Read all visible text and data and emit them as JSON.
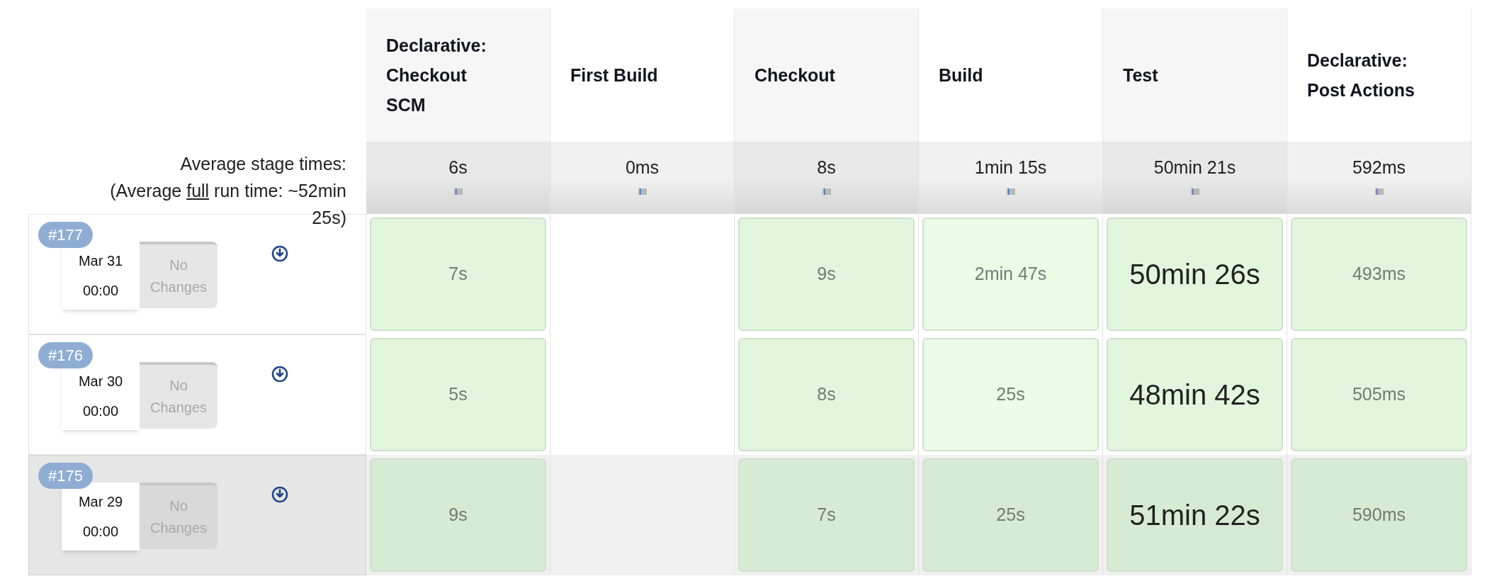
{
  "stages": [
    {
      "name": "Declarative: Checkout SCM",
      "average": "6s"
    },
    {
      "name": "First Build",
      "average": "0ms"
    },
    {
      "name": "Checkout",
      "average": "8s"
    },
    {
      "name": "Build",
      "average": "1min 15s"
    },
    {
      "name": "Test",
      "average": "50min 21s"
    },
    {
      "name": "Declarative: Post Actions",
      "average": "592ms"
    }
  ],
  "average_label": "Average stage times:",
  "average_run_time": {
    "before": "(Average ",
    "link": "full",
    "after": " run time: ~52min 25s)"
  },
  "builds": [
    {
      "number": "#177",
      "date": "Mar 31",
      "time": "00:00",
      "changes": "No Changes",
      "highlighted": false,
      "cells": [
        {
          "kind": "success",
          "duration": "7s",
          "long": false
        },
        {
          "kind": "empty"
        },
        {
          "kind": "success",
          "duration": "9s",
          "long": false
        },
        {
          "kind": "success",
          "duration": "2min 47s",
          "long": false
        },
        {
          "kind": "success",
          "duration": "50min 26s",
          "long": true
        },
        {
          "kind": "success",
          "duration": "493ms",
          "long": false
        }
      ]
    },
    {
      "number": "#176",
      "date": "Mar 30",
      "time": "00:00",
      "changes": "No Changes",
      "highlighted": false,
      "cells": [
        {
          "kind": "success",
          "duration": "5s",
          "long": false
        },
        {
          "kind": "empty"
        },
        {
          "kind": "success",
          "duration": "8s",
          "long": false
        },
        {
          "kind": "success",
          "duration": "25s",
          "long": false
        },
        {
          "kind": "success",
          "duration": "48min 42s",
          "long": true
        },
        {
          "kind": "success",
          "duration": "505ms",
          "long": false
        }
      ]
    },
    {
      "number": "#175",
      "date": "Mar 29",
      "time": "00:00",
      "changes": "No Changes",
      "highlighted": true,
      "cells": [
        {
          "kind": "success",
          "duration": "9s",
          "long": false
        },
        {
          "kind": "empty"
        },
        {
          "kind": "success",
          "duration": "7s",
          "long": false
        },
        {
          "kind": "success",
          "duration": "25s",
          "long": false
        },
        {
          "kind": "success",
          "duration": "51min 22s",
          "long": true
        },
        {
          "kind": "success",
          "duration": "590ms",
          "long": false
        }
      ]
    }
  ]
}
